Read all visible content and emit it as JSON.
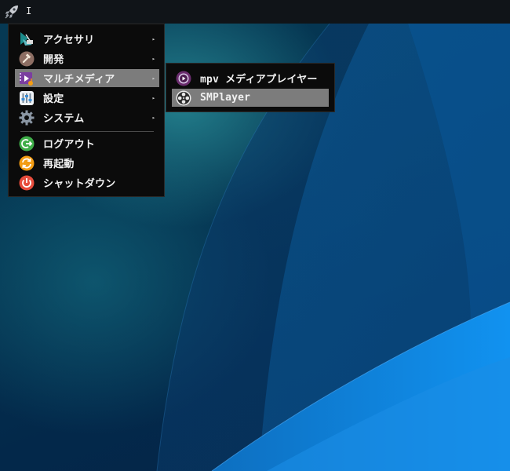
{
  "topbar": {
    "launcher_icon": "rocket-icon",
    "cursor_text": "I"
  },
  "menu": {
    "items": [
      {
        "label": "アクセサリ",
        "icon": "accessories-icon",
        "has_submenu": true
      },
      {
        "label": "開発",
        "icon": "development-icon",
        "has_submenu": true
      },
      {
        "label": "マルチメディア",
        "icon": "multimedia-icon",
        "has_submenu": true,
        "highlighted": true
      },
      {
        "label": "設定",
        "icon": "settings-icon",
        "has_submenu": true
      },
      {
        "label": "システム",
        "icon": "system-gear-icon",
        "has_submenu": true
      }
    ],
    "actions": [
      {
        "label": "ログアウト",
        "icon": "logout-icon"
      },
      {
        "label": "再起動",
        "icon": "restart-icon"
      },
      {
        "label": "シャットダウン",
        "icon": "shutdown-icon"
      }
    ],
    "submenu_arrow": "▸"
  },
  "submenu": {
    "items": [
      {
        "label": "mpv メディアプレイヤー",
        "icon": "mpv-icon"
      },
      {
        "label": "SMPlayer",
        "icon": "smplayer-icon",
        "highlighted": true
      }
    ]
  },
  "colors": {
    "menu_bg": "#0b0b0b",
    "highlight_bg": "#7c7c7c",
    "topbar_bg": "#101418",
    "logout_green": "#3fae49",
    "restart_orange": "#f39c12",
    "shutdown_red": "#e74c3c",
    "mpv_purple": "#6b2d6e"
  }
}
